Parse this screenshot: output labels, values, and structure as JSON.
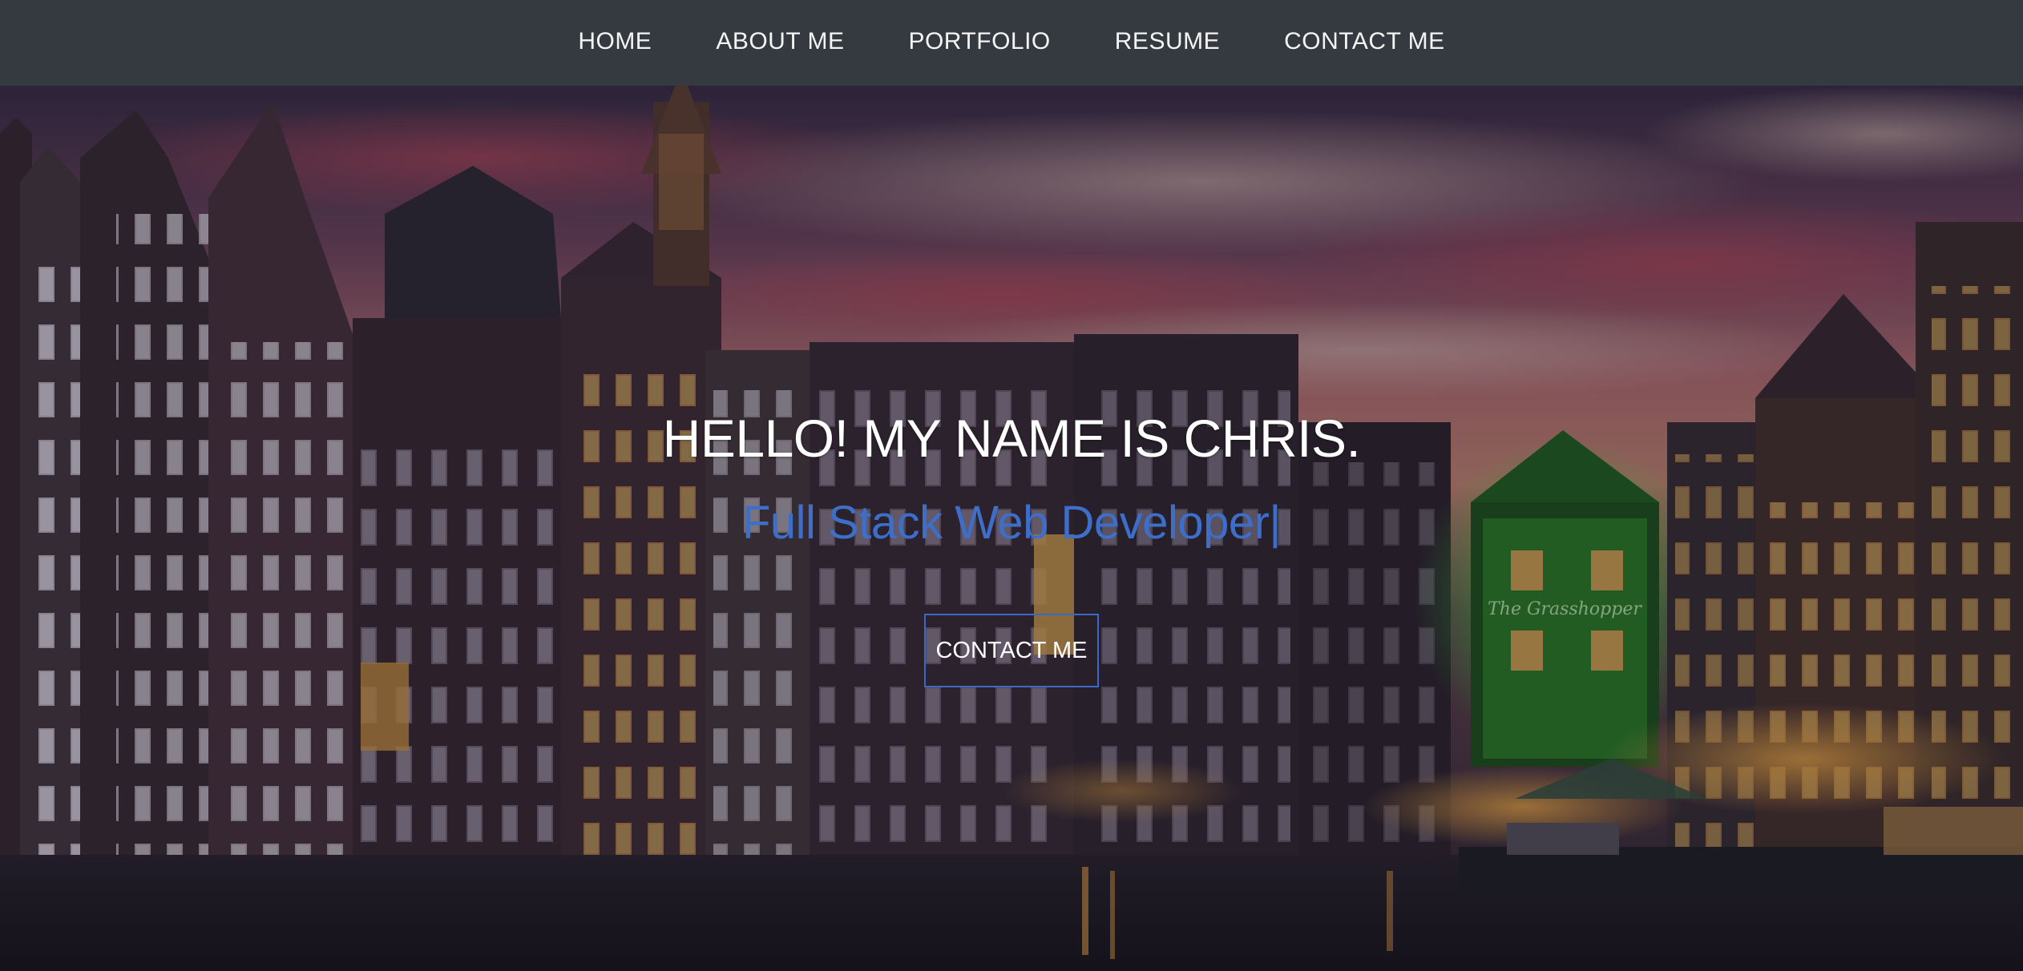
{
  "nav": {
    "items": [
      {
        "label": "HOME"
      },
      {
        "label": "ABOUT ME"
      },
      {
        "label": "PORTFOLIO"
      },
      {
        "label": "RESUME"
      },
      {
        "label": "CONTACT ME"
      }
    ]
  },
  "hero": {
    "title": "HELLO! MY NAME IS CHRIS.",
    "subtitle": "Full Stack Web Developer",
    "cursor": "|",
    "button_label": "CONTACT ME",
    "background_image": "canal-city-buildings-at-sunset",
    "sign_text": "The Grasshopper"
  },
  "colors": {
    "navbar_bg": "#343a40",
    "accent_blue": "#3d6ec9",
    "title_text": "#ffffff"
  }
}
